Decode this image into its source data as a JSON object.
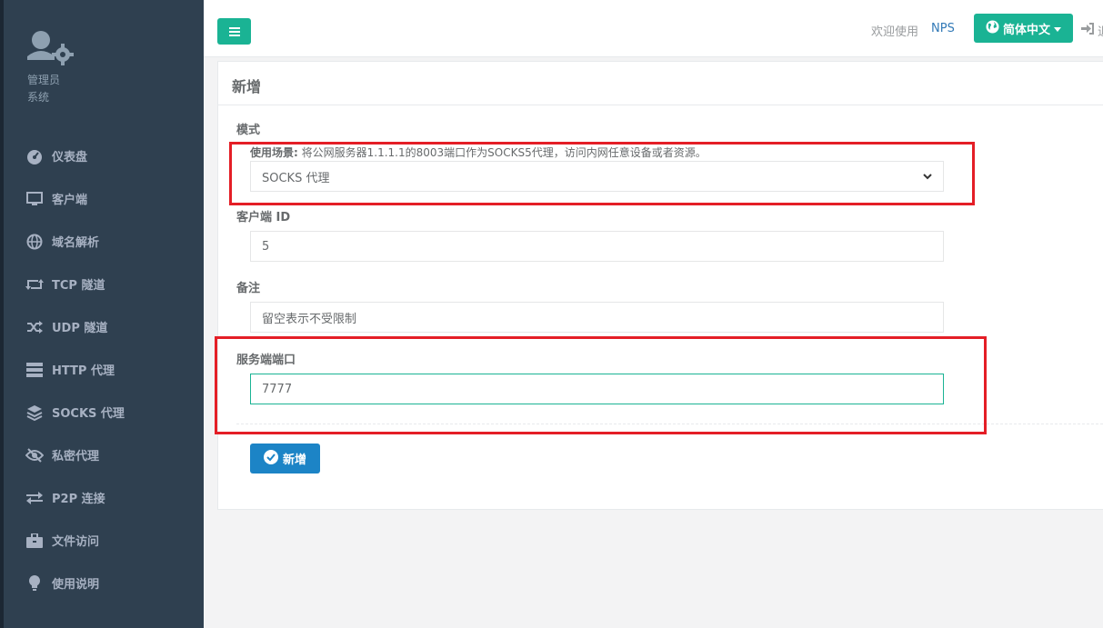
{
  "sidebar": {
    "role_title": "管理员",
    "role_sub": "系统",
    "items": [
      {
        "label": "仪表盘",
        "icon": "dashboard-icon"
      },
      {
        "label": "客户端",
        "icon": "monitor-icon"
      },
      {
        "label": "域名解析",
        "icon": "globe-icon"
      },
      {
        "label": "TCP 隧道",
        "icon": "retweet-icon"
      },
      {
        "label": "UDP 隧道",
        "icon": "shuffle-icon"
      },
      {
        "label": "HTTP 代理",
        "icon": "server-icon"
      },
      {
        "label": "SOCKS 代理",
        "icon": "layers-icon"
      },
      {
        "label": "私密代理",
        "icon": "eye-slash-icon"
      },
      {
        "label": "P2P 连接",
        "icon": "exchange-icon"
      },
      {
        "label": "文件访问",
        "icon": "briefcase-icon"
      },
      {
        "label": "使用说明",
        "icon": "lightbulb-icon"
      }
    ]
  },
  "header": {
    "welcome": "欢迎使用",
    "brand_link": "NPS",
    "language": "简体中文",
    "logout_partial": "退"
  },
  "form": {
    "title": "新增",
    "mode_label": "模式",
    "hint_prefix": "使用场景:",
    "hint_text": " 将公网服务器1.1.1.1的8003端口作为SOCKS5代理，访问内网任意设备或者资源。",
    "mode_value": "SOCKS 代理",
    "client_id_label": "客户端 ID",
    "client_id_value": "5",
    "remark_label": "备注",
    "remark_placeholder": "留空表示不受限制",
    "port_label": "服务端端口",
    "port_value": "7777",
    "submit_label": "新增"
  },
  "colors": {
    "sidebar_bg": "#2f4050",
    "accent_green": "#1ab394",
    "primary_blue": "#1c84c6",
    "highlight_red": "#e41e26"
  }
}
